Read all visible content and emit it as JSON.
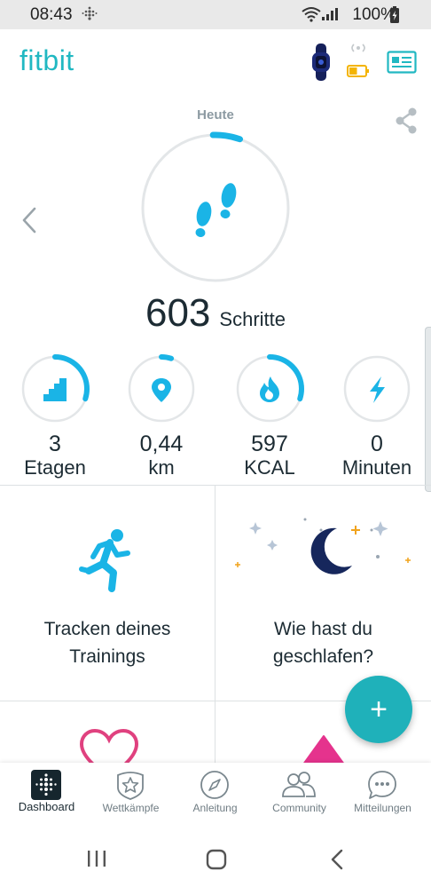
{
  "status_bar": {
    "time": "08:43",
    "battery_percent": "100%"
  },
  "header": {
    "logo": "fitbit",
    "device_battery_level": 0.5,
    "icons": [
      "tracker-band-icon",
      "device-battery-icon",
      "profile-card-icon"
    ]
  },
  "summary": {
    "date_label": "Heute",
    "steps_value": "603",
    "steps_unit": "Schritte",
    "steps_progress": 0.06,
    "icons": [
      "share-icon",
      "chevron-left-icon",
      "footsteps-icon"
    ]
  },
  "stats": [
    {
      "value": "3",
      "unit": "Etagen",
      "progress": 0.3,
      "icon": "stairs-icon"
    },
    {
      "value": "0,44",
      "unit": "km",
      "progress": 0.05,
      "icon": "location-pin-icon"
    },
    {
      "value": "597",
      "unit": "KCAL",
      "progress": 0.3,
      "icon": "flame-icon"
    },
    {
      "value": "0",
      "unit": "Minuten",
      "progress": 0.0,
      "icon": "lightning-icon"
    }
  ],
  "tiles": {
    "exercise_text": "Tracken deines Trainings",
    "exercise_line1": "Tracken deines",
    "exercise_line2": "Trainings",
    "sleep_line1": "Wie hast du",
    "sleep_line2": "geschlafen?",
    "icons": [
      "runner-icon",
      "moon-stars-icon",
      "heart-icon",
      "triangle-icon"
    ]
  },
  "fab_label": "+",
  "bottom_nav": [
    {
      "label": "Dashboard",
      "icon": "dashboard-icon",
      "active": true
    },
    {
      "label": "Wettkämpfe",
      "icon": "star-badge-icon",
      "active": false
    },
    {
      "label": "Anleitung",
      "icon": "compass-icon",
      "active": false
    },
    {
      "label": "Community",
      "icon": "people-icon",
      "active": false
    },
    {
      "label": "Mitteilungen",
      "icon": "chat-bubble-icon",
      "active": false
    }
  ],
  "colors": {
    "accent": "#21b8c2",
    "progress": "#1ab4e6",
    "ring_track": "#e3e6e8",
    "text": "#1c2b33",
    "sleep_moon": "#16275c",
    "heart": "#e0417f",
    "triangle": "#e5338d"
  }
}
